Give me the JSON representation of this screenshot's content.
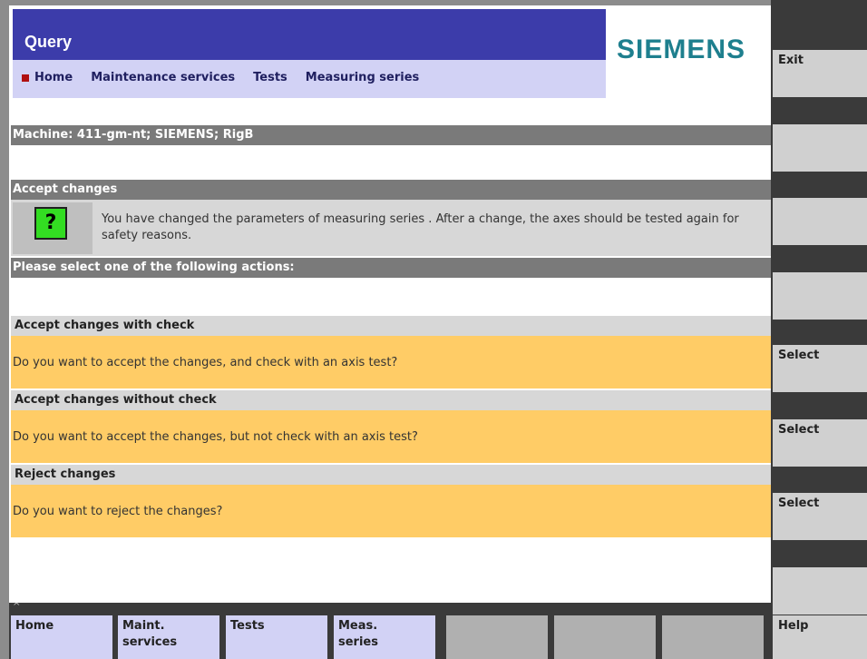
{
  "header": {
    "title": "Query",
    "logo": "SIEMENS",
    "nav": [
      "Home",
      "Maintenance services",
      "Tests",
      "Measuring series"
    ]
  },
  "machine_label": "Machine: 411-gm-nt; SIEMENS; RigB",
  "accept_header": "Accept changes",
  "message": {
    "icon": "question-icon",
    "icon_glyph": "?",
    "text": "You have changed the parameters of measuring series . After a change, the axes should be tested again for safety reasons."
  },
  "select_prompt": "Please select one of the following actions:",
  "actions": [
    {
      "title": "Accept changes with check",
      "question": "Do you want to accept the changes, and check with an axis test?"
    },
    {
      "title": "Accept changes without check",
      "question": "Do you want to accept the changes, but not check with an axis test?"
    },
    {
      "title": "Reject changes",
      "question": "Do you want to reject the changes?"
    }
  ],
  "softkeys": {
    "exit": "Exit",
    "select1": "Select",
    "select2": "Select",
    "select3": "Select",
    "help": "Help"
  },
  "hkeys": {
    "home": "Home",
    "maint_l1": "Maint.",
    "maint_l2": "services",
    "tests": "Tests",
    "meas_l1": "Meas.",
    "meas_l2": "series"
  },
  "colors": {
    "title_bar": "#3c3caa",
    "nav_bar": "#d2d2f5",
    "highlight": "#ffcc66",
    "logo": "#1e7f8e",
    "question_icon": "#33dd22"
  }
}
